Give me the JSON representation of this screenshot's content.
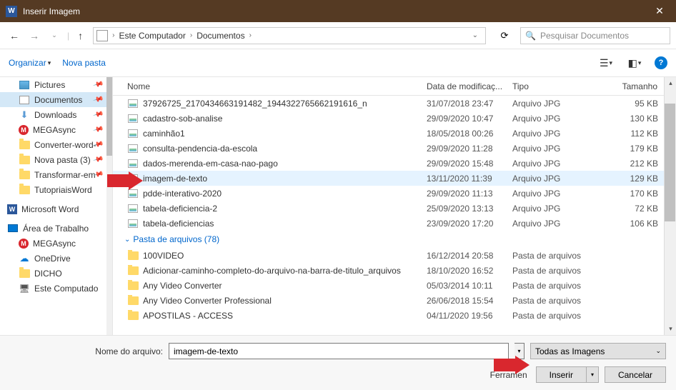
{
  "titlebar": {
    "title": "Inserir Imagem"
  },
  "breadcrumb": {
    "items": [
      "Este Computador",
      "Documentos"
    ]
  },
  "search": {
    "placeholder": "Pesquisar Documentos"
  },
  "toolbar": {
    "organize": "Organizar",
    "newfolder": "Nova pasta"
  },
  "sidebar": {
    "items": [
      {
        "label": "Pictures",
        "iconClass": "fi-pictures",
        "pin": true
      },
      {
        "label": "Documentos",
        "iconClass": "fi-docs",
        "pin": true,
        "selected": true
      },
      {
        "label": "Downloads",
        "iconClass": "fi-dl",
        "glyph": "⬇",
        "pin": true
      },
      {
        "label": "MEGAsync",
        "iconClass": "fi-mega",
        "glyph": "M",
        "pin": true
      },
      {
        "label": "Converter-word-",
        "iconClass": "folder-icon",
        "pin": true
      },
      {
        "label": "Nova pasta (3)",
        "iconClass": "folder-icon",
        "pin": true
      },
      {
        "label": "Transformar-em",
        "iconClass": "folder-icon",
        "pin": true
      },
      {
        "label": "TutopriaisWord",
        "iconClass": "folder-icon"
      }
    ],
    "items2": [
      {
        "label": "Microsoft Word",
        "iconClass": "fi-word",
        "glyph": "W",
        "section": true
      },
      {
        "label": "Área de Trabalho",
        "iconClass": "fi-desk",
        "section": true
      },
      {
        "label": "MEGAsync",
        "iconClass": "fi-mega",
        "glyph": "M"
      },
      {
        "label": "OneDrive",
        "iconClass": "fi-cloud",
        "glyph": "☁"
      },
      {
        "label": "DICHO",
        "iconClass": "folder-icon"
      },
      {
        "label": "Este Computado",
        "iconClass": "fi-pc",
        "glyph": "🖥"
      }
    ]
  },
  "columns": {
    "name": "Nome",
    "date": "Data de modificaç...",
    "type": "Tipo",
    "size": "Tamanho"
  },
  "files": [
    {
      "name": "37926725_2170434663191482_1944322765662191616_n",
      "date": "31/07/2018 23:47",
      "type": "Arquivo JPG",
      "size": "95 KB"
    },
    {
      "name": "cadastro-sob-analise",
      "date": "29/09/2020 10:47",
      "type": "Arquivo JPG",
      "size": "130 KB"
    },
    {
      "name": "caminhão1",
      "date": "18/05/2018 00:26",
      "type": "Arquivo JPG",
      "size": "112 KB"
    },
    {
      "name": "consulta-pendencia-da-escola",
      "date": "29/09/2020 11:28",
      "type": "Arquivo JPG",
      "size": "179 KB"
    },
    {
      "name": "dados-merenda-em-casa-nao-pago",
      "date": "29/09/2020 15:48",
      "type": "Arquivo JPG",
      "size": "212 KB"
    },
    {
      "name": "imagem-de-texto",
      "date": "13/11/2020 11:39",
      "type": "Arquivo JPG",
      "size": "129 KB",
      "hl": true
    },
    {
      "name": "pdde-interativo-2020",
      "date": "29/09/2020 11:13",
      "type": "Arquivo JPG",
      "size": "170 KB"
    },
    {
      "name": "tabela-deficiencia-2",
      "date": "25/09/2020 13:13",
      "type": "Arquivo JPG",
      "size": "72 KB"
    },
    {
      "name": "tabela-deficiencias",
      "date": "23/09/2020 17:20",
      "type": "Arquivo JPG",
      "size": "106 KB"
    }
  ],
  "group": {
    "label": "Pasta de arquivos (78)"
  },
  "folders": [
    {
      "name": "100VIDEO",
      "date": "16/12/2014 20:58",
      "type": "Pasta de arquivos"
    },
    {
      "name": "Adicionar-caminho-completo-do-arquivo-na-barra-de-titulo_arquivos",
      "date": "18/10/2020 16:52",
      "type": "Pasta de arquivos"
    },
    {
      "name": "Any Video Converter",
      "date": "05/03/2014 10:11",
      "type": "Pasta de arquivos"
    },
    {
      "name": "Any Video Converter Professional",
      "date": "26/06/2018 15:54",
      "type": "Pasta de arquivos"
    },
    {
      "name": "APOSTILAS - ACCESS",
      "date": "04/11/2020 19:56",
      "type": "Pasta de arquivos"
    }
  ],
  "bottom": {
    "fnlabel": "Nome do arquivo:",
    "fnvalue": "imagem-de-texto",
    "filter": "Todas as Imagens",
    "tools": "Ferramen",
    "insert": "Inserir",
    "cancel": "Cancelar"
  }
}
